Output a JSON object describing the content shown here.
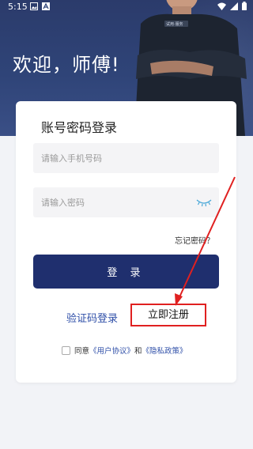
{
  "status_bar": {
    "time": "5:15"
  },
  "hero": {
    "welcome": "欢迎，师傅!"
  },
  "login_card": {
    "title": "账号密码登录",
    "phone_placeholder": "请输入手机号码",
    "password_placeholder": "请输入密码",
    "forgot_password": "忘记密码？",
    "login_button": "登 录",
    "sms_login": "验证码登录",
    "register": "立即注册",
    "agreement": {
      "prefix": "同意",
      "user_agreement": "《用户协议》",
      "and": "和",
      "privacy_policy": "《隐私政策》"
    }
  },
  "colors": {
    "hero_bg": "#2f4478",
    "primary_button": "#1f2f6e",
    "link": "#2f4fa8",
    "annotation": "#e02020"
  }
}
